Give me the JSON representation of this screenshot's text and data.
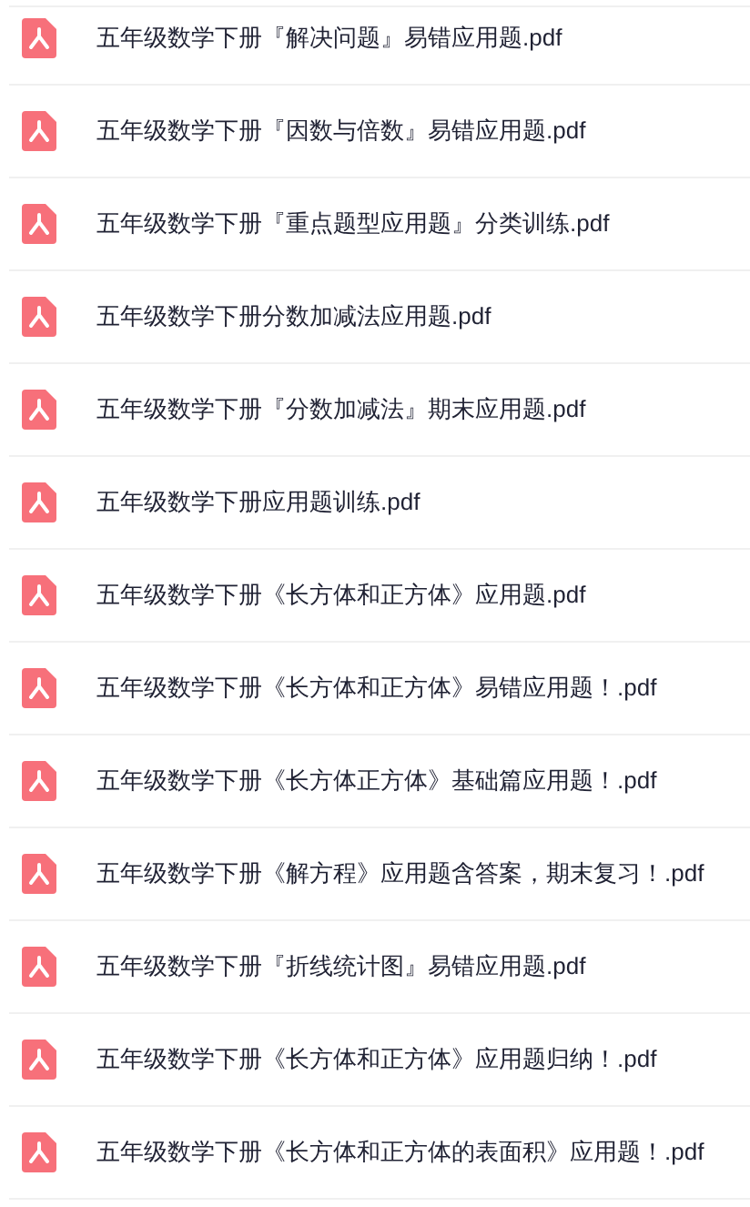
{
  "files": [
    {
      "name": "五年级数学下册『解决问题』易错应用题.pdf"
    },
    {
      "name": "五年级数学下册『因数与倍数』易错应用题.pdf"
    },
    {
      "name": "五年级数学下册『重点题型应用题』分类训练.pdf"
    },
    {
      "name": "五年级数学下册分数加减法应用题.pdf"
    },
    {
      "name": "五年级数学下册『分数加减法』期末应用题.pdf"
    },
    {
      "name": "五年级数学下册应用题训练.pdf"
    },
    {
      "name": "五年级数学下册《长方体和正方体》应用题.pdf"
    },
    {
      "name": "五年级数学下册《长方体和正方体》易错应用题！.pdf"
    },
    {
      "name": "五年级数学下册《长方体正方体》基础篇应用题！.pdf"
    },
    {
      "name": "五年级数学下册《解方程》应用题含答案，期末复习！.pdf"
    },
    {
      "name": "五年级数学下册『折线统计图』易错应用题.pdf"
    },
    {
      "name": "五年级数学下册《长方体和正方体》应用题归纳！.pdf"
    },
    {
      "name": "五年级数学下册《长方体和正方体的表面积》应用题！.pdf"
    }
  ]
}
